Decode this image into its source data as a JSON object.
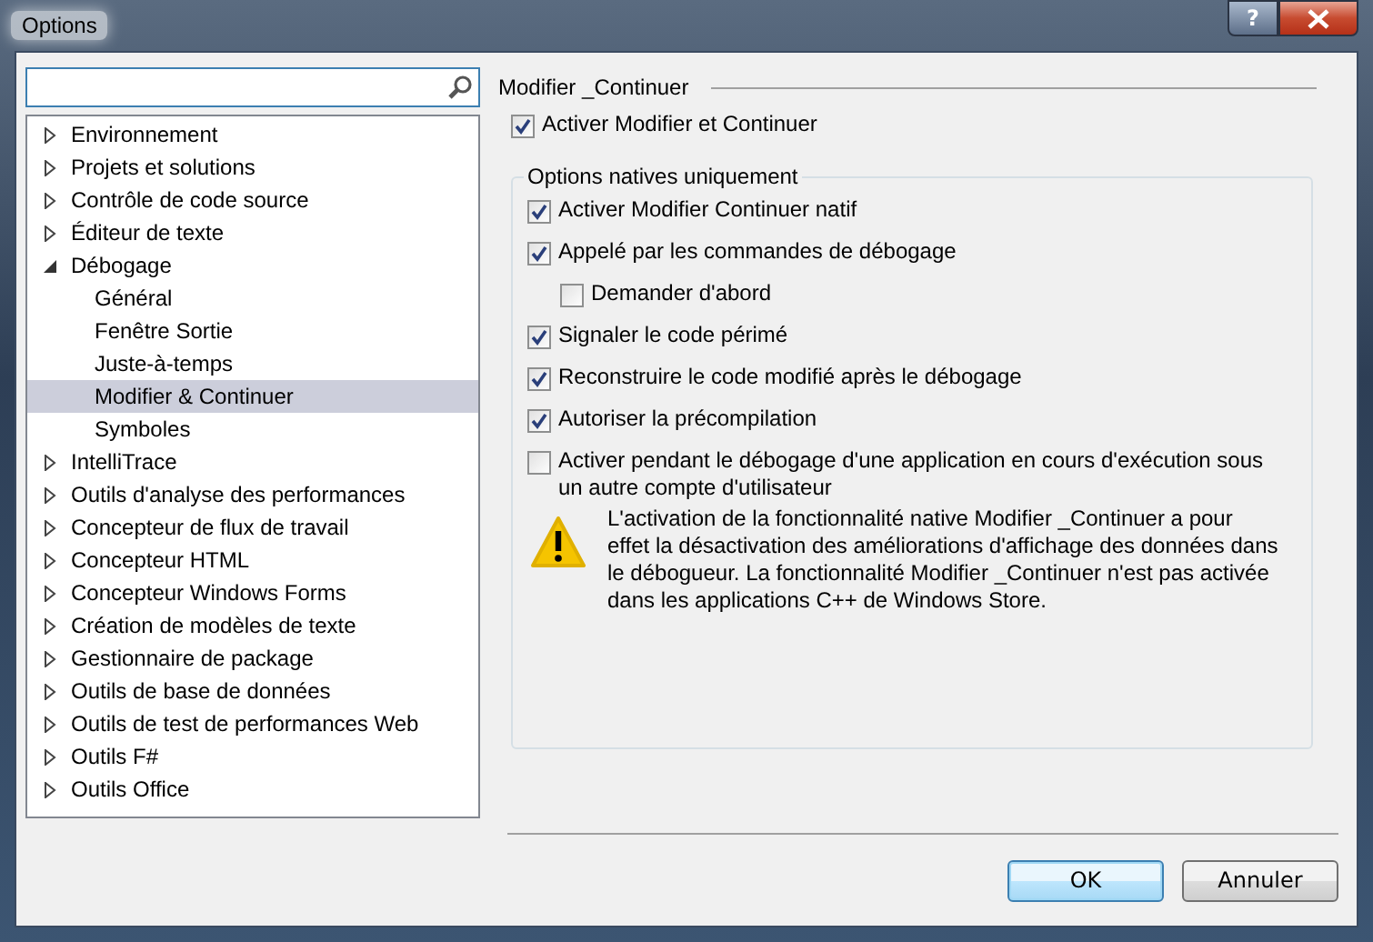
{
  "window": {
    "title": "Options",
    "help": "?"
  },
  "tree": [
    {
      "label": "Environnement",
      "expanded": false,
      "selected": false
    },
    {
      "label": "Projets et solutions",
      "expanded": false,
      "selected": false
    },
    {
      "label": "Contrôle de code source",
      "expanded": false,
      "selected": false
    },
    {
      "label": "Éditeur de texte",
      "expanded": false,
      "selected": false
    },
    {
      "label": "Débogage",
      "expanded": true,
      "selected": false,
      "children": [
        {
          "label": "Général",
          "selected": false
        },
        {
          "label": "Fenêtre Sortie",
          "selected": false
        },
        {
          "label": "Juste-à-temps",
          "selected": false
        },
        {
          "label": "Modifier & Continuer",
          "selected": true
        },
        {
          "label": "Symboles",
          "selected": false
        }
      ]
    },
    {
      "label": "IntelliTrace",
      "expanded": false,
      "selected": false
    },
    {
      "label": "Outils d'analyse des performances",
      "expanded": false,
      "selected": false
    },
    {
      "label": "Concepteur de flux de travail",
      "expanded": false,
      "selected": false
    },
    {
      "label": "Concepteur HTML",
      "expanded": false,
      "selected": false
    },
    {
      "label": "Concepteur Windows Forms",
      "expanded": false,
      "selected": false
    },
    {
      "label": "Création de modèles de texte",
      "expanded": false,
      "selected": false
    },
    {
      "label": "Gestionnaire de package",
      "expanded": false,
      "selected": false
    },
    {
      "label": "Outils de base de données",
      "expanded": false,
      "selected": false
    },
    {
      "label": "Outils de test de performances Web",
      "expanded": false,
      "selected": false
    },
    {
      "label": "Outils F#",
      "expanded": false,
      "selected": false
    },
    {
      "label": "Outils Office",
      "expanded": false,
      "selected": false
    }
  ],
  "section_title": "Modifier _Continuer",
  "main_option": {
    "label": "Activer Modifier et Continuer",
    "checked": true
  },
  "group": {
    "title": "Options natives uniquement",
    "options": [
      {
        "label": "Activer Modifier  Continuer natif",
        "checked": true,
        "indented": false
      },
      {
        "label": "Appelé par les commandes de débogage",
        "checked": true,
        "indented": false
      },
      {
        "label": "Demander d'abord",
        "checked": false,
        "indented": true
      },
      {
        "label": "Signaler le code périmé",
        "checked": true,
        "indented": false
      },
      {
        "label": "Reconstruire le code modifié après le débogage",
        "checked": true,
        "indented": false
      },
      {
        "label": "Autoriser la précompilation",
        "checked": true,
        "indented": false
      },
      {
        "label": "Activer pendant le débogage d'une application en cours d'exécution sous un autre compte d'utilisateur",
        "checked": false,
        "indented": false
      }
    ],
    "warning": "L'activation de la fonctionnalité native Modifier _Continuer a pour effet la désactivation des améliorations d'affichage des données dans le débogueur. La fonctionnalité Modifier _Continuer n'est pas activée dans les applications C++ de Windows Store."
  },
  "buttons": [
    {
      "label": "OK",
      "default": true
    },
    {
      "label": "Annuler",
      "default": false
    }
  ]
}
